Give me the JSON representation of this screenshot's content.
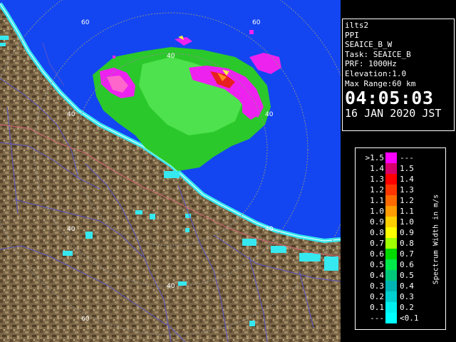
{
  "map": {
    "ring_labels": [
      "60",
      "40",
      "60",
      "40",
      "40",
      "40",
      "40",
      "40",
      "60"
    ],
    "colors": {
      "land": "#7a6546",
      "sea": "#1346f0",
      "coast": "#36e8ef",
      "echo_green": "#2bc82b",
      "echo_bright": "#4ee34e",
      "echo_magenta": "#ee22ee",
      "echo_pink": "#ff66cc",
      "echo_red": "#e82020",
      "echo_orange": "#ff9020",
      "echo_yellow": "#ffff3a"
    }
  },
  "info": {
    "name": "ilts2",
    "mode": "PPI",
    "scan": "SEAICE_B_W",
    "task": "Task: SEAICE_B",
    "prf": "PRF: 1000Hz",
    "elevation": "Elevation:1.0",
    "max_range": "Max Range:60 km",
    "time": "04:05:03",
    "date": "16 JAN 2020 JST"
  },
  "legend": {
    "title": "Spectrum Width in m/s",
    "rows": [
      {
        "left": ">1.5",
        "right": "---",
        "color": "#ff00ff"
      },
      {
        "left": "1.4",
        "right": "1.5",
        "color": "#d8006a"
      },
      {
        "left": "1.3",
        "right": "1.4",
        "color": "#ff0000"
      },
      {
        "left": "1.2",
        "right": "1.3",
        "color": "#ff3500"
      },
      {
        "left": "1.1",
        "right": "1.2",
        "color": "#ff6a00"
      },
      {
        "left": "1.0",
        "right": "1.1",
        "color": "#ff9c00"
      },
      {
        "left": "0.9",
        "right": "1.0",
        "color": "#ffd000"
      },
      {
        "left": "0.8",
        "right": "0.9",
        "color": "#ffff00"
      },
      {
        "left": "0.7",
        "right": "0.8",
        "color": "#a0ff00"
      },
      {
        "left": "0.6",
        "right": "0.7",
        "color": "#00d800"
      },
      {
        "left": "0.5",
        "right": "0.6",
        "color": "#00e84a"
      },
      {
        "left": "0.4",
        "right": "0.5",
        "color": "#00c87a"
      },
      {
        "left": "0.3",
        "right": "0.4",
        "color": "#00b4b4"
      },
      {
        "left": "0.2",
        "right": "0.3",
        "color": "#00d0d0"
      },
      {
        "left": "0.1",
        "right": "0.2",
        "color": "#00f0f0"
      },
      {
        "left": "---",
        "right": "<0.1",
        "color": "#00ffff"
      }
    ]
  }
}
